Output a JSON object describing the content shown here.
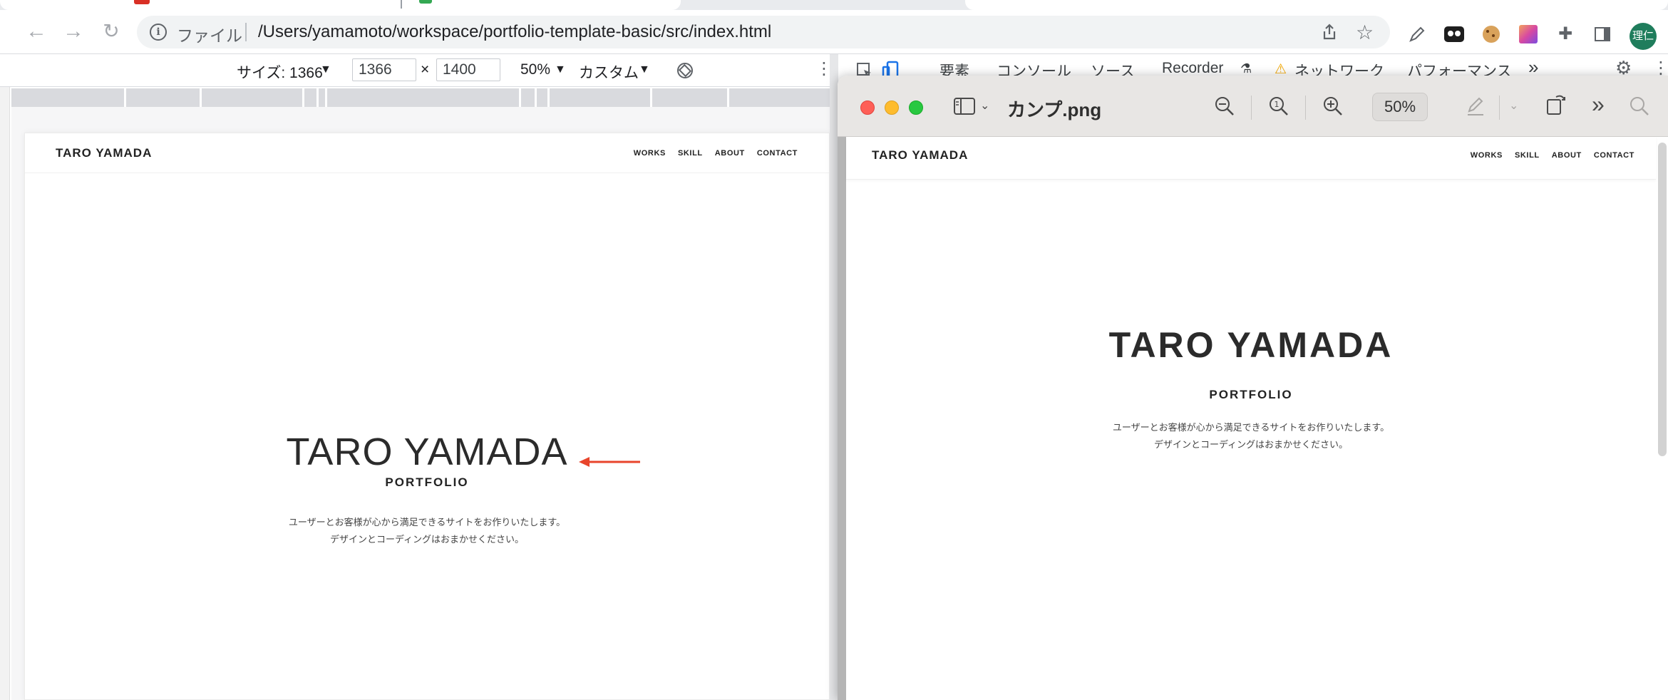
{
  "browser": {
    "url_chip": "ファイル",
    "url": "/Users/yamamoto/workspace/portfolio-template-basic/src/index.html",
    "profile_initials": "理仁",
    "icons": [
      "back-icon",
      "forward-icon",
      "reload-icon",
      "info-icon",
      "share-icon",
      "star-icon",
      "pen-extension-icon",
      "tape-extension-icon",
      "cookie-extension-icon",
      "gradient-extension-icon",
      "puzzle-icon",
      "sidebar-icon"
    ]
  },
  "device_toolbar": {
    "size_label": "サイズ: 1366",
    "width": "1366",
    "times": "×",
    "height": "1400",
    "zoom": "50%",
    "throttle": "カスタム",
    "rotate_icon": "rotate-icon",
    "more_icon": "more-vert-icon"
  },
  "devtools": {
    "tabs": [
      "要素",
      "コンソール",
      "ソース",
      "Recorder",
      "ネットワーク",
      "パフォーマンス"
    ],
    "more": "»"
  },
  "site": {
    "logo": "TARO YAMADA",
    "nav": [
      "WORKS",
      "SKILL",
      "ABOUT",
      "CONTACT"
    ],
    "hero_title": "TARO YAMADA",
    "hero_subtitle": "PORTFOLIO",
    "hero_text_line1": "ユーザーとお客様が心から満足できるサイトをお作りいたします。",
    "hero_text_line2": "デザインとコーディングはおまかせください。",
    "annotation_color": "#e8452c"
  },
  "preview": {
    "title": "カンプ.png",
    "zoom": "50%",
    "more": "»"
  }
}
